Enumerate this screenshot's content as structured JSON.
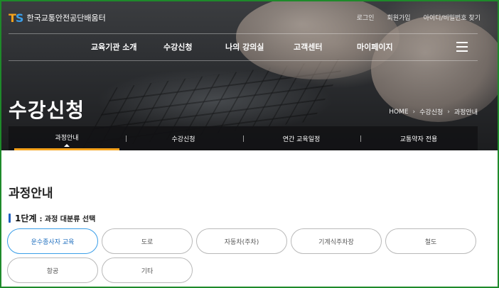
{
  "header": {
    "logo_mark_t": "T",
    "logo_mark_s": "S",
    "logo_text": "한국교통안전공단배움터",
    "util_links": [
      "로그인",
      "회원가입",
      "아이디/비밀번호 찾기"
    ]
  },
  "gnb": {
    "items": [
      "교육기관 소개",
      "수강신청",
      "나의 강의실",
      "고객센터",
      "마이페이지"
    ]
  },
  "page": {
    "title": "수강신청",
    "breadcrumb": [
      "HOME",
      "수강신청",
      "과정안내"
    ]
  },
  "subnav": {
    "tabs": [
      "과정안내",
      "수강신청",
      "연간 교육일정",
      "교통약자 전용"
    ],
    "active_index": 0
  },
  "content": {
    "title": "과정안내",
    "step_number": "1단계",
    "step_label": ": 과정 대분류 선택",
    "categories": [
      "운수종사자 교육",
      "도로",
      "자동차(주차)",
      "기계식주차장",
      "철도",
      "항공",
      "기타"
    ],
    "selected_category": "운수종사자 교육"
  },
  "colors": {
    "accent": "#f5a21b",
    "logo_blue": "#3a9ee8",
    "step_bar": "#1f5fbf",
    "frame": "#1e8a2a"
  },
  "icons": {
    "menu": "hamburger-icon",
    "breadcrumb_separator": "chevron-right-icon"
  }
}
